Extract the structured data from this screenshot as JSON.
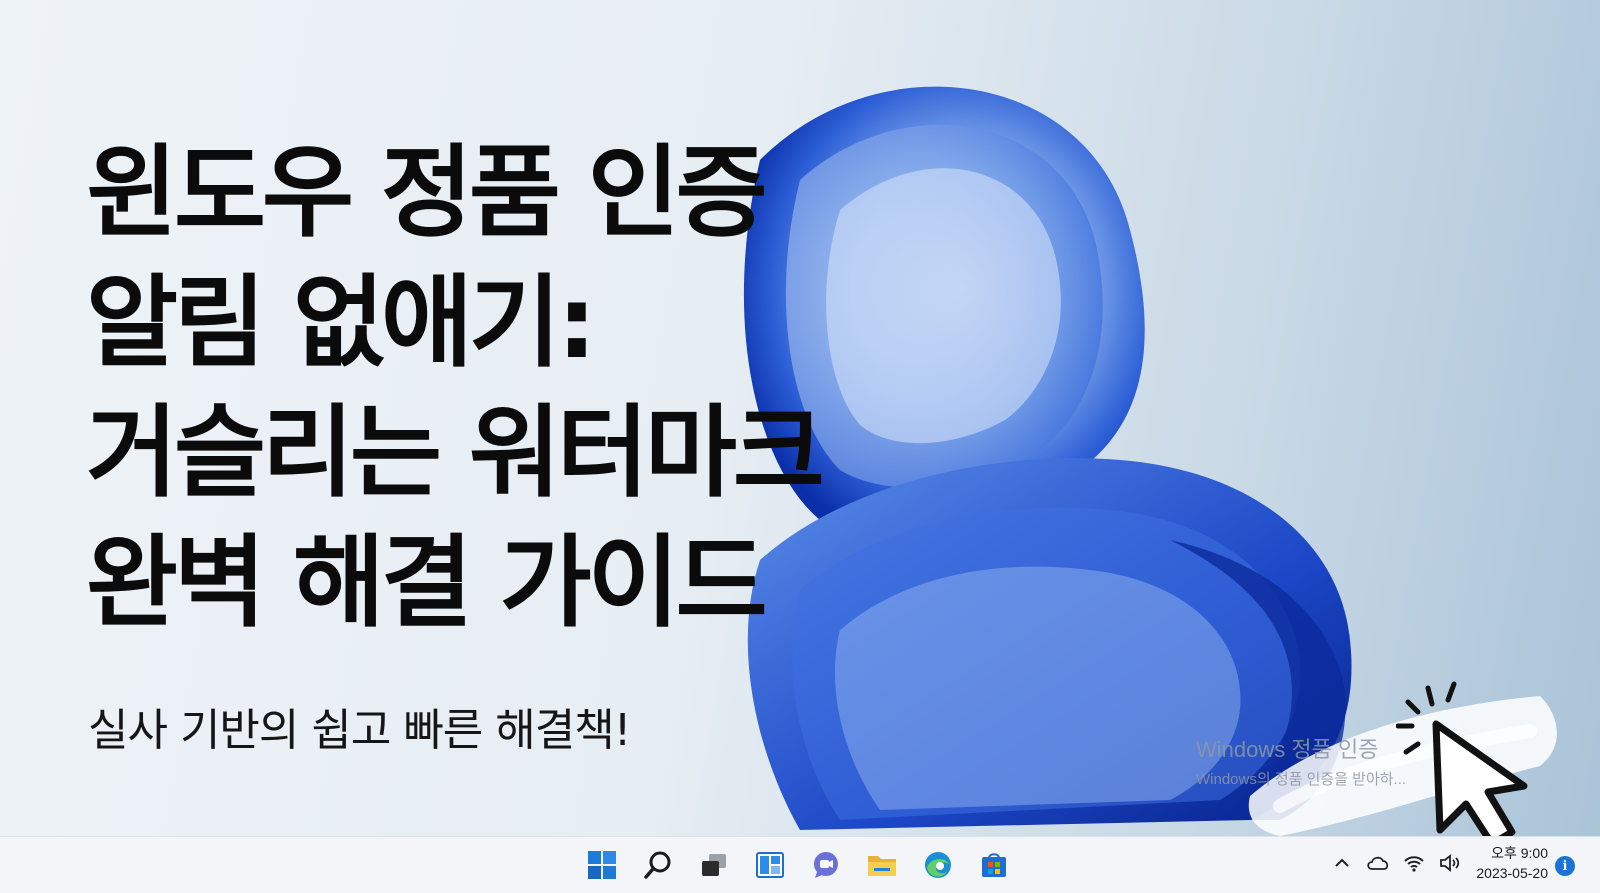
{
  "headline": {
    "line1": "윈도우 정품 인증",
    "line2": "알림 없애기:",
    "line3": "거슬리는 워터마크",
    "line4": "완벽 해결 가이드"
  },
  "subtitle": "실사 기반의 쉽고 빠른 해결책!",
  "watermark": {
    "title": "Windows 정품 인증",
    "detail": "Windows의 정품 인증을 받아하..."
  },
  "taskbar": {
    "icons": [
      "windows-start-icon",
      "search-icon",
      "task-view-icon",
      "widgets-icon",
      "chat-icon",
      "file-explorer-icon",
      "edge-icon",
      "store-icon"
    ]
  },
  "tray": {
    "time": "오후 9:00",
    "date": "2023-05-20",
    "icons": [
      "chevron-up-icon",
      "cloud-icon",
      "wifi-icon",
      "speaker-icon",
      "info-icon"
    ]
  },
  "colors": {
    "accent": "#1a73d9",
    "bloom_dark": "#0a2fa8",
    "bloom_light": "#6ea6f0",
    "text": "#0b0b0b"
  }
}
